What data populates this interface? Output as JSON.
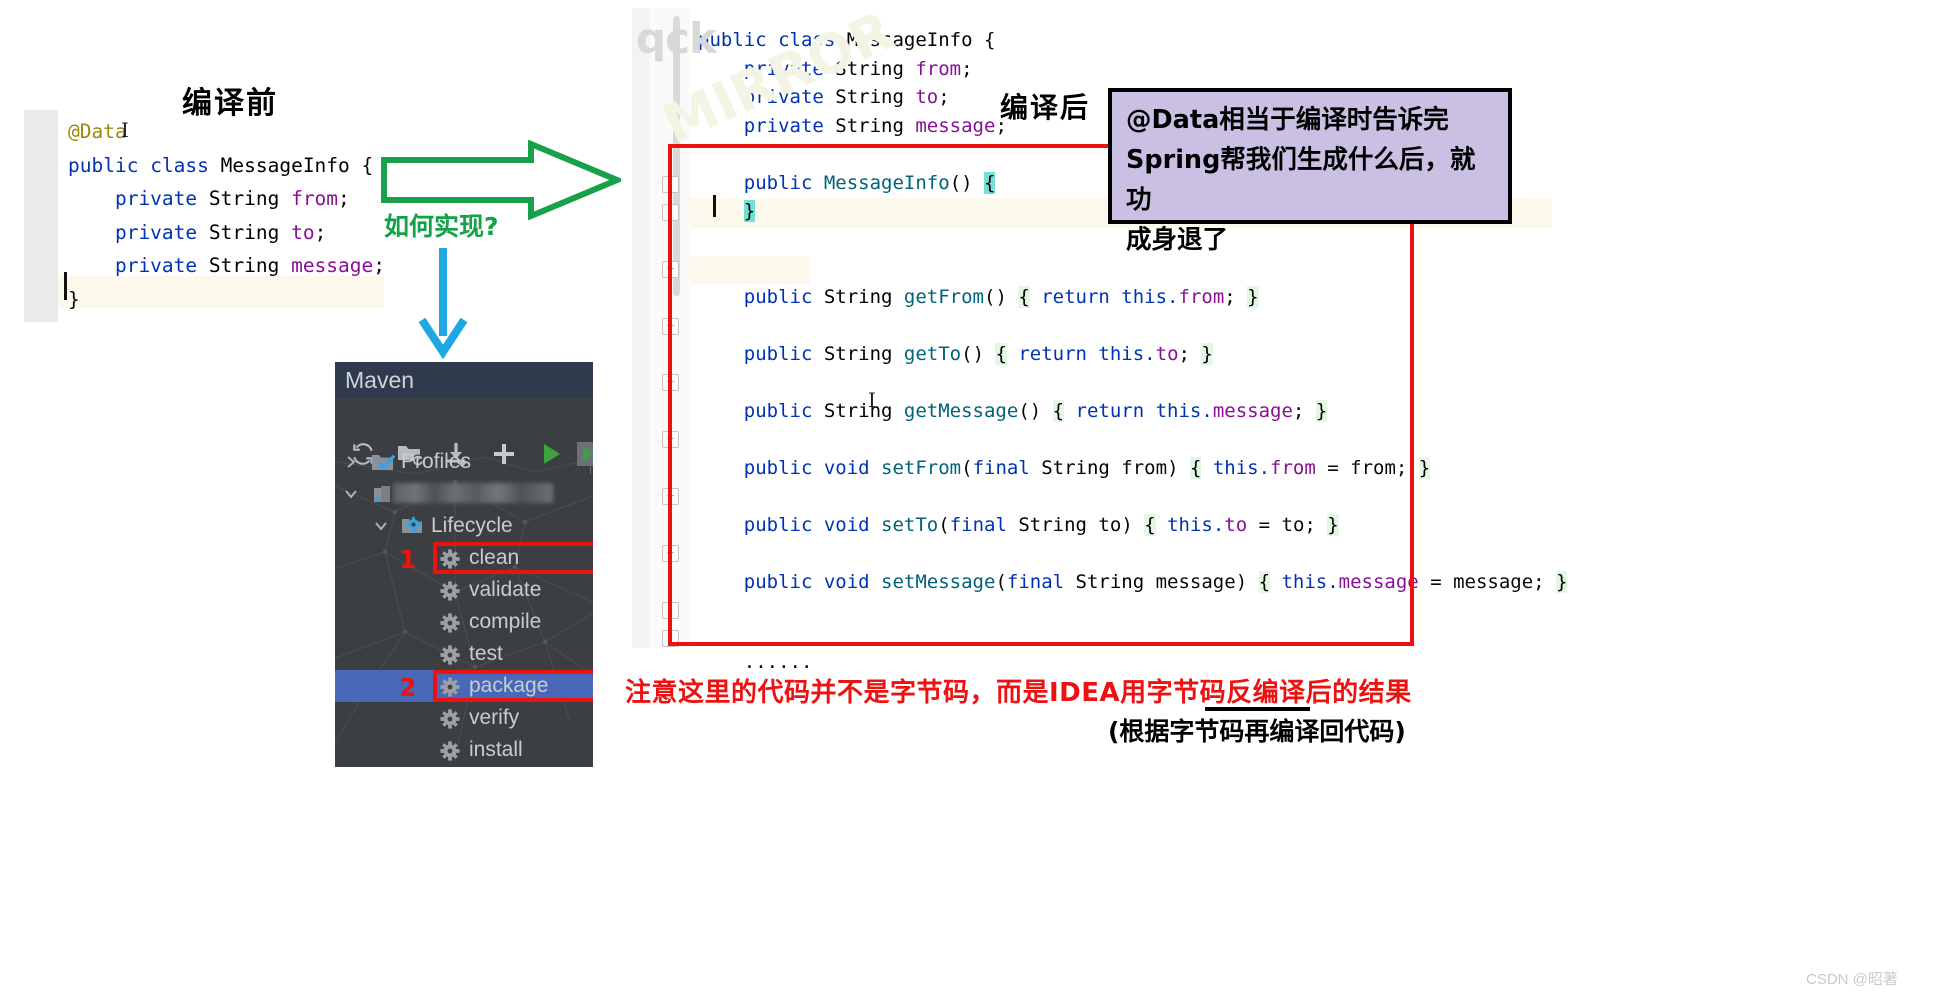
{
  "labels": {
    "before_title": "编译前",
    "after_title": "编译后",
    "how_to": "如何实现?"
  },
  "before_editor": {
    "name": "before-compile-code",
    "lines": [
      [
        {
          "t": "@Data",
          "c": "anno"
        }
      ],
      [
        {
          "t": "public ",
          "c": "kw"
        },
        {
          "t": "class ",
          "c": "kw"
        },
        {
          "t": "MessageInfo ",
          "c": "cls"
        },
        {
          "t": "{",
          "c": "plain"
        }
      ],
      [
        {
          "t": "    private ",
          "c": "kw"
        },
        {
          "t": "String ",
          "c": "type"
        },
        {
          "t": "from",
          "c": "fieldv"
        },
        {
          "t": ";",
          "c": "plain"
        }
      ],
      [
        {
          "t": "    private ",
          "c": "kw"
        },
        {
          "t": "String ",
          "c": "type"
        },
        {
          "t": "to",
          "c": "fieldv"
        },
        {
          "t": ";",
          "c": "plain"
        }
      ],
      [
        {
          "t": "    private ",
          "c": "kw"
        },
        {
          "t": "String ",
          "c": "type"
        },
        {
          "t": "message",
          "c": "fieldv"
        },
        {
          "t": ";",
          "c": "plain"
        }
      ],
      [
        {
          "t": "}",
          "c": "plain"
        }
      ]
    ]
  },
  "after_editor": {
    "name": "after-compile-decompiled-code",
    "watermark_top": "qck",
    "watermark_diag": "MIRROR",
    "lines": [
      [
        {
          "t": "public ",
          "c": "kw"
        },
        {
          "t": "class ",
          "c": "kw"
        },
        {
          "t": "MessageInfo ",
          "c": "cls"
        },
        {
          "t": "{",
          "c": "plain"
        }
      ],
      [
        {
          "t": "    private ",
          "c": "kw"
        },
        {
          "t": "String ",
          "c": "type"
        },
        {
          "t": "from",
          "c": "fieldv"
        },
        {
          "t": ";",
          "c": "plain"
        }
      ],
      [
        {
          "t": "    private ",
          "c": "kw"
        },
        {
          "t": "String ",
          "c": "type"
        },
        {
          "t": "to",
          "c": "fieldv"
        },
        {
          "t": ";",
          "c": "plain"
        }
      ],
      [
        {
          "t": "    private ",
          "c": "kw"
        },
        {
          "t": "String ",
          "c": "type"
        },
        {
          "t": "message",
          "c": "fieldv"
        },
        {
          "t": ";",
          "c": "plain"
        }
      ],
      [],
      [
        {
          "t": "    public ",
          "c": "kw"
        },
        {
          "t": "MessageInfo",
          "c": "method"
        },
        {
          "t": "() ",
          "c": "plain"
        },
        {
          "t": "{",
          "c": "cy"
        }
      ],
      [
        {
          "t": "    ",
          "c": "plain"
        },
        {
          "t": "}",
          "c": "cy"
        }
      ],
      [],
      [],
      [
        {
          "t": "    public ",
          "c": "kw"
        },
        {
          "t": "String ",
          "c": "type"
        },
        {
          "t": "getFrom",
          "c": "method"
        },
        {
          "t": "() ",
          "c": "plain"
        },
        {
          "t": "{",
          "c": "hl"
        },
        {
          "t": " return ",
          "c": "kw"
        },
        {
          "t": "this.",
          "c": "kw"
        },
        {
          "t": "from",
          "c": "fieldv"
        },
        {
          "t": "; ",
          "c": "plain"
        },
        {
          "t": "}",
          "c": "hl"
        }
      ],
      [],
      [
        {
          "t": "    public ",
          "c": "kw"
        },
        {
          "t": "String ",
          "c": "type"
        },
        {
          "t": "getTo",
          "c": "method"
        },
        {
          "t": "() ",
          "c": "plain"
        },
        {
          "t": "{",
          "c": "hl"
        },
        {
          "t": " return ",
          "c": "kw"
        },
        {
          "t": "this.",
          "c": "kw"
        },
        {
          "t": "to",
          "c": "fieldv"
        },
        {
          "t": "; ",
          "c": "plain"
        },
        {
          "t": "}",
          "c": "hl"
        }
      ],
      [],
      [
        {
          "t": "    public ",
          "c": "kw"
        },
        {
          "t": "String ",
          "c": "type"
        },
        {
          "t": "getMessage",
          "c": "method"
        },
        {
          "t": "() ",
          "c": "plain"
        },
        {
          "t": "{",
          "c": "hl"
        },
        {
          "t": " return ",
          "c": "kw"
        },
        {
          "t": "this.",
          "c": "kw"
        },
        {
          "t": "message",
          "c": "fieldv"
        },
        {
          "t": "; ",
          "c": "plain"
        },
        {
          "t": "}",
          "c": "hl"
        }
      ],
      [],
      [
        {
          "t": "    public ",
          "c": "kw"
        },
        {
          "t": "void ",
          "c": "kw"
        },
        {
          "t": "setFrom",
          "c": "method"
        },
        {
          "t": "(",
          "c": "plain"
        },
        {
          "t": "final ",
          "c": "kw"
        },
        {
          "t": "String ",
          "c": "type"
        },
        {
          "t": "from",
          "c": "plain"
        },
        {
          "t": ") ",
          "c": "plain"
        },
        {
          "t": "{",
          "c": "hl"
        },
        {
          "t": " this.",
          "c": "kw"
        },
        {
          "t": "from ",
          "c": "fieldv"
        },
        {
          "t": "= from; ",
          "c": "plain"
        },
        {
          "t": "}",
          "c": "hl"
        }
      ],
      [],
      [
        {
          "t": "    public ",
          "c": "kw"
        },
        {
          "t": "void ",
          "c": "kw"
        },
        {
          "t": "setTo",
          "c": "method"
        },
        {
          "t": "(",
          "c": "plain"
        },
        {
          "t": "final ",
          "c": "kw"
        },
        {
          "t": "String ",
          "c": "type"
        },
        {
          "t": "to",
          "c": "plain"
        },
        {
          "t": ") ",
          "c": "plain"
        },
        {
          "t": "{",
          "c": "hl"
        },
        {
          "t": " this.",
          "c": "kw"
        },
        {
          "t": "to ",
          "c": "fieldv"
        },
        {
          "t": "= to; ",
          "c": "plain"
        },
        {
          "t": "}",
          "c": "hl"
        }
      ],
      [],
      [
        {
          "t": "    public ",
          "c": "kw"
        },
        {
          "t": "void ",
          "c": "kw"
        },
        {
          "t": "setMessage",
          "c": "method"
        },
        {
          "t": "(",
          "c": "plain"
        },
        {
          "t": "final ",
          "c": "kw"
        },
        {
          "t": "String ",
          "c": "type"
        },
        {
          "t": "message",
          "c": "plain"
        },
        {
          "t": ") ",
          "c": "plain"
        },
        {
          "t": "{",
          "c": "hl"
        },
        {
          "t": " this.",
          "c": "kw"
        },
        {
          "t": "message ",
          "c": "fieldv"
        },
        {
          "t": "= message; ",
          "c": "plain"
        },
        {
          "t": "}",
          "c": "hl"
        }
      ],
      [],
      [],
      [
        {
          "t": "    ······",
          "c": "plain"
        }
      ]
    ]
  },
  "purple_note": {
    "line1": "@Data相当于编译时告诉完",
    "line2": "Spring帮我们生成什么后，就功",
    "line3": "成身退了",
    "bg_color": "#c9c0e4",
    "border_color": "#000000"
  },
  "bottom_notes": {
    "red_note": "注意这里的代码并不是字节码，而是IDEA用字节码反编译后的结果",
    "black_note": "(根据字节码再编译回代码)",
    "red_color": "#ee1111"
  },
  "maven": {
    "title": "Maven",
    "toolbar": [
      {
        "name": "reload-all-projects-icon",
        "glyph": "reload"
      },
      {
        "name": "reload-project-icon",
        "glyph": "folder-reload"
      },
      {
        "name": "download-sources-icon",
        "glyph": "download"
      },
      {
        "name": "add-maven-project-icon",
        "glyph": "plus"
      },
      {
        "name": "run-maven-build-icon",
        "glyph": "run"
      },
      {
        "name": "execute-goal-icon",
        "glyph": "execute"
      }
    ],
    "tree": [
      {
        "label": "Profiles",
        "indent": 36,
        "chevron": "right",
        "icon": "profiles-icon",
        "selected": false,
        "badge": null,
        "outlined": false
      },
      {
        "label": "",
        "indent": 36,
        "chevron": "down",
        "icon": "project-icon",
        "selected": false,
        "badge": null,
        "outlined": false,
        "blurred": true
      },
      {
        "label": "Lifecycle",
        "indent": 66,
        "chevron": "down",
        "icon": "lifecycle-folder-icon",
        "selected": false,
        "badge": null,
        "outlined": false
      },
      {
        "label": "clean",
        "indent": 104,
        "chevron": "",
        "icon": "gear-icon",
        "selected": false,
        "badge": "1",
        "outlined": true
      },
      {
        "label": "validate",
        "indent": 104,
        "chevron": "",
        "icon": "gear-icon",
        "selected": false,
        "badge": null,
        "outlined": false
      },
      {
        "label": "compile",
        "indent": 104,
        "chevron": "",
        "icon": "gear-icon",
        "selected": false,
        "badge": null,
        "outlined": false
      },
      {
        "label": "test",
        "indent": 104,
        "chevron": "",
        "icon": "gear-icon",
        "selected": false,
        "badge": null,
        "outlined": false
      },
      {
        "label": "package",
        "indent": 104,
        "chevron": "",
        "icon": "gear-icon",
        "selected": true,
        "badge": "2",
        "outlined": true
      },
      {
        "label": "verify",
        "indent": 104,
        "chevron": "",
        "icon": "gear-icon",
        "selected": false,
        "badge": null,
        "outlined": false
      },
      {
        "label": "install",
        "indent": 104,
        "chevron": "",
        "icon": "gear-icon",
        "selected": false,
        "badge": null,
        "outlined": false
      }
    ],
    "selection_color": "#4a68b8",
    "panel_bg": "#3c3f41",
    "title_bg": "#2f3b4d"
  },
  "watermark": {
    "csdn": "CSDN @昭著"
  }
}
